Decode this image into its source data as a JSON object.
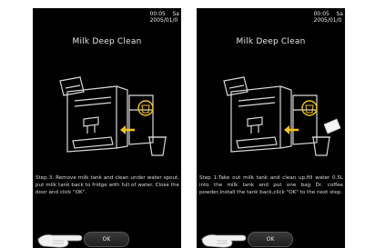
{
  "screens": [
    {
      "status": {
        "time": "00:05",
        "day": "Sa",
        "date": "2005/01/0"
      },
      "title": "Milk Deep Clean",
      "step_text": "Step 3: Remove milk tank and clean under water spout, put milk tank back to fridge with full of water. Close the door and click \"OK\".",
      "ok_label": "OK",
      "colors": {
        "highlight": "#f0c419",
        "background": "#000000"
      }
    },
    {
      "status": {
        "time": "00:05",
        "day": "Sa",
        "date": "2005/01/0"
      },
      "title": "Milk Deep Clean",
      "step_text": "Step 1:Take out milk tank and clean up,fill water 0.5L into the milk tank and put one bag Dr. coffee powder,install the tank back,click \"OK\" to the next step.",
      "ok_label": "OK",
      "colors": {
        "highlight": "#f0c419",
        "background": "#000000"
      }
    }
  ]
}
